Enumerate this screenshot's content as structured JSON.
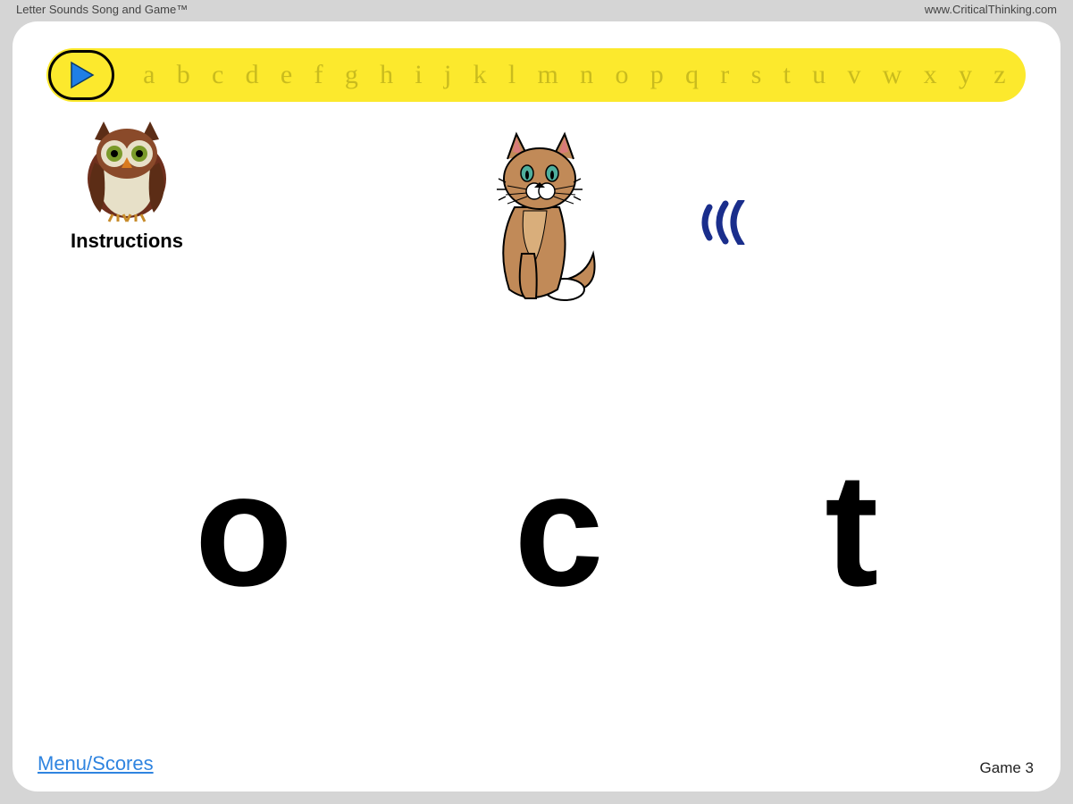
{
  "topbar": {
    "title": "Letter Sounds Song and Game™",
    "site": "www.CriticalThinking.com"
  },
  "alphabet": [
    "a",
    "b",
    "c",
    "d",
    "e",
    "f",
    "g",
    "h",
    "i",
    "j",
    "k",
    "l",
    "m",
    "n",
    "o",
    "p",
    "q",
    "r",
    "s",
    "t",
    "u",
    "v",
    "w",
    "x",
    "y",
    "z"
  ],
  "instructions": {
    "label": "Instructions",
    "icon": "owl-icon"
  },
  "word_image": {
    "name": "cat",
    "icon": "cat-icon"
  },
  "sound_cue": {
    "icon": "sound-waves-icon"
  },
  "choices": [
    "o",
    "c",
    "t"
  ],
  "footer": {
    "menu_link": "Menu/Scores",
    "game_label": "Game 3"
  }
}
